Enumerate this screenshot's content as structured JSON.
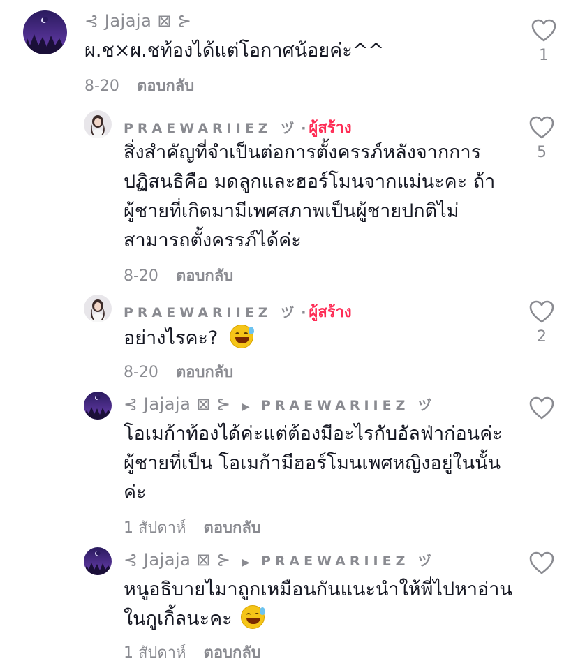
{
  "comments": [
    {
      "username": "⊰ Jajaja ⊠ ⊱",
      "text": "ผ.ช×ผ.ชท้องได้แต่โอกาศน้อยค่ะ^^",
      "date": "8-20",
      "reply_label": "ตอบกลับ",
      "likes": "1"
    },
    {
      "username": "PRAEWARIIEZ ヅ",
      "creator_badge": "ผู้สร้าง",
      "separator": "·",
      "text": "สิ่งสำคัญที่จำเป็นต่อการตั้งครรภ์หลังจากการปฏิสนธิคือ มดลูกและฮอร์โมนจากแม่นะคะ ถ้าผู้ชายที่เกิดมามีเพศสภาพเป็นผู้ชายปกติไม่สามารถตั้งครรภ์ได้ค่ะ",
      "date": "8-20",
      "reply_label": "ตอบกลับ",
      "likes": "5"
    },
    {
      "username": "PRAEWARIIEZ ヅ",
      "creator_badge": "ผู้สร้าง",
      "separator": "·",
      "text": "อย่างไรคะ?",
      "emoji": "grinning-sweat-emoji",
      "date": "8-20",
      "reply_label": "ตอบกลับ",
      "likes": "2"
    },
    {
      "username": "⊰ Jajaja ⊠ ⊱",
      "reply_to": "PRAEWARIIEZ ヅ",
      "text": "โอเมก้าท้องได้ค่ะแต่ต้องมีอะไรกับอัลฟ่าก่อนค่ะผู้ชายที่เป็น โอเมก้ามีฮอร์โมนเพศหญิงอยู่ในนั้นค่ะ",
      "date": "1 สัปดาห์",
      "reply_label": "ตอบกลับ",
      "likes": ""
    },
    {
      "username": "⊰ Jajaja ⊠ ⊱",
      "reply_to": "PRAEWARIIEZ ヅ",
      "text": "หนูอธิบายไมาถูกเหมือนกันแนะนำให้พี่ไปหาอ่าน ในกูเกิ้ลนะคะ",
      "emoji": "grinning-sweat-emoji",
      "date": "1 สัปดาห์",
      "reply_label": "ตอบกลับ",
      "likes": ""
    }
  ],
  "colors": {
    "creator": "#fe2c55",
    "muted": "#8a8b91",
    "text": "#161823"
  },
  "icons": {
    "like": "heart-outline-icon",
    "reply_arrow": "play-arrow-icon"
  }
}
